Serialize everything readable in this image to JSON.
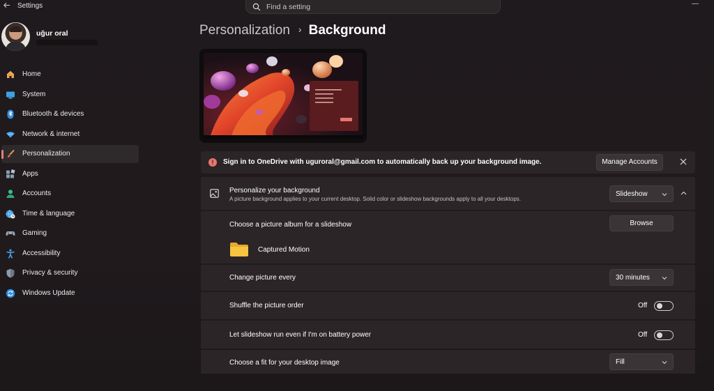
{
  "app": {
    "title": "Settings"
  },
  "search": {
    "placeholder": "Find a setting"
  },
  "profile": {
    "name": "uğur oral"
  },
  "nav": {
    "items": [
      {
        "label": "Home",
        "icon": "home-icon"
      },
      {
        "label": "System",
        "icon": "monitor-icon"
      },
      {
        "label": "Bluetooth & devices",
        "icon": "bluetooth-icon"
      },
      {
        "label": "Network & internet",
        "icon": "wifi-icon"
      },
      {
        "label": "Personalization",
        "icon": "brush-icon",
        "active": true
      },
      {
        "label": "Apps",
        "icon": "apps-icon"
      },
      {
        "label": "Accounts",
        "icon": "person-icon"
      },
      {
        "label": "Time & language",
        "icon": "globe-clock-icon"
      },
      {
        "label": "Gaming",
        "icon": "gamepad-icon"
      },
      {
        "label": "Accessibility",
        "icon": "accessibility-icon"
      },
      {
        "label": "Privacy & security",
        "icon": "shield-icon"
      },
      {
        "label": "Windows Update",
        "icon": "update-icon"
      }
    ]
  },
  "breadcrumb": {
    "parent": "Personalization",
    "separator": "›",
    "current": "Background"
  },
  "banner": {
    "text": "Sign in to OneDrive with uguroral@gmail.com to automatically back up your background image.",
    "button": "Manage Accounts"
  },
  "personalize": {
    "title": "Personalize your background",
    "subtitle": "A picture background applies to your current desktop. Solid color or slideshow backgrounds apply to all your desktops.",
    "value": "Slideshow"
  },
  "album": {
    "title": "Choose a picture album for a slideshow",
    "button": "Browse",
    "folder": "Captured Motion"
  },
  "change_every": {
    "title": "Change picture every",
    "value": "30 minutes"
  },
  "shuffle": {
    "title": "Shuffle the picture order",
    "state": "Off"
  },
  "battery": {
    "title": "Let slideshow run even if I'm on battery power",
    "state": "Off"
  },
  "fit": {
    "title": "Choose a fit for your desktop image",
    "value": "Fill"
  },
  "colors": {
    "accent": "#e5807a",
    "background": "#201a1d",
    "card": "#2b2528",
    "folder": "#f5c441"
  }
}
